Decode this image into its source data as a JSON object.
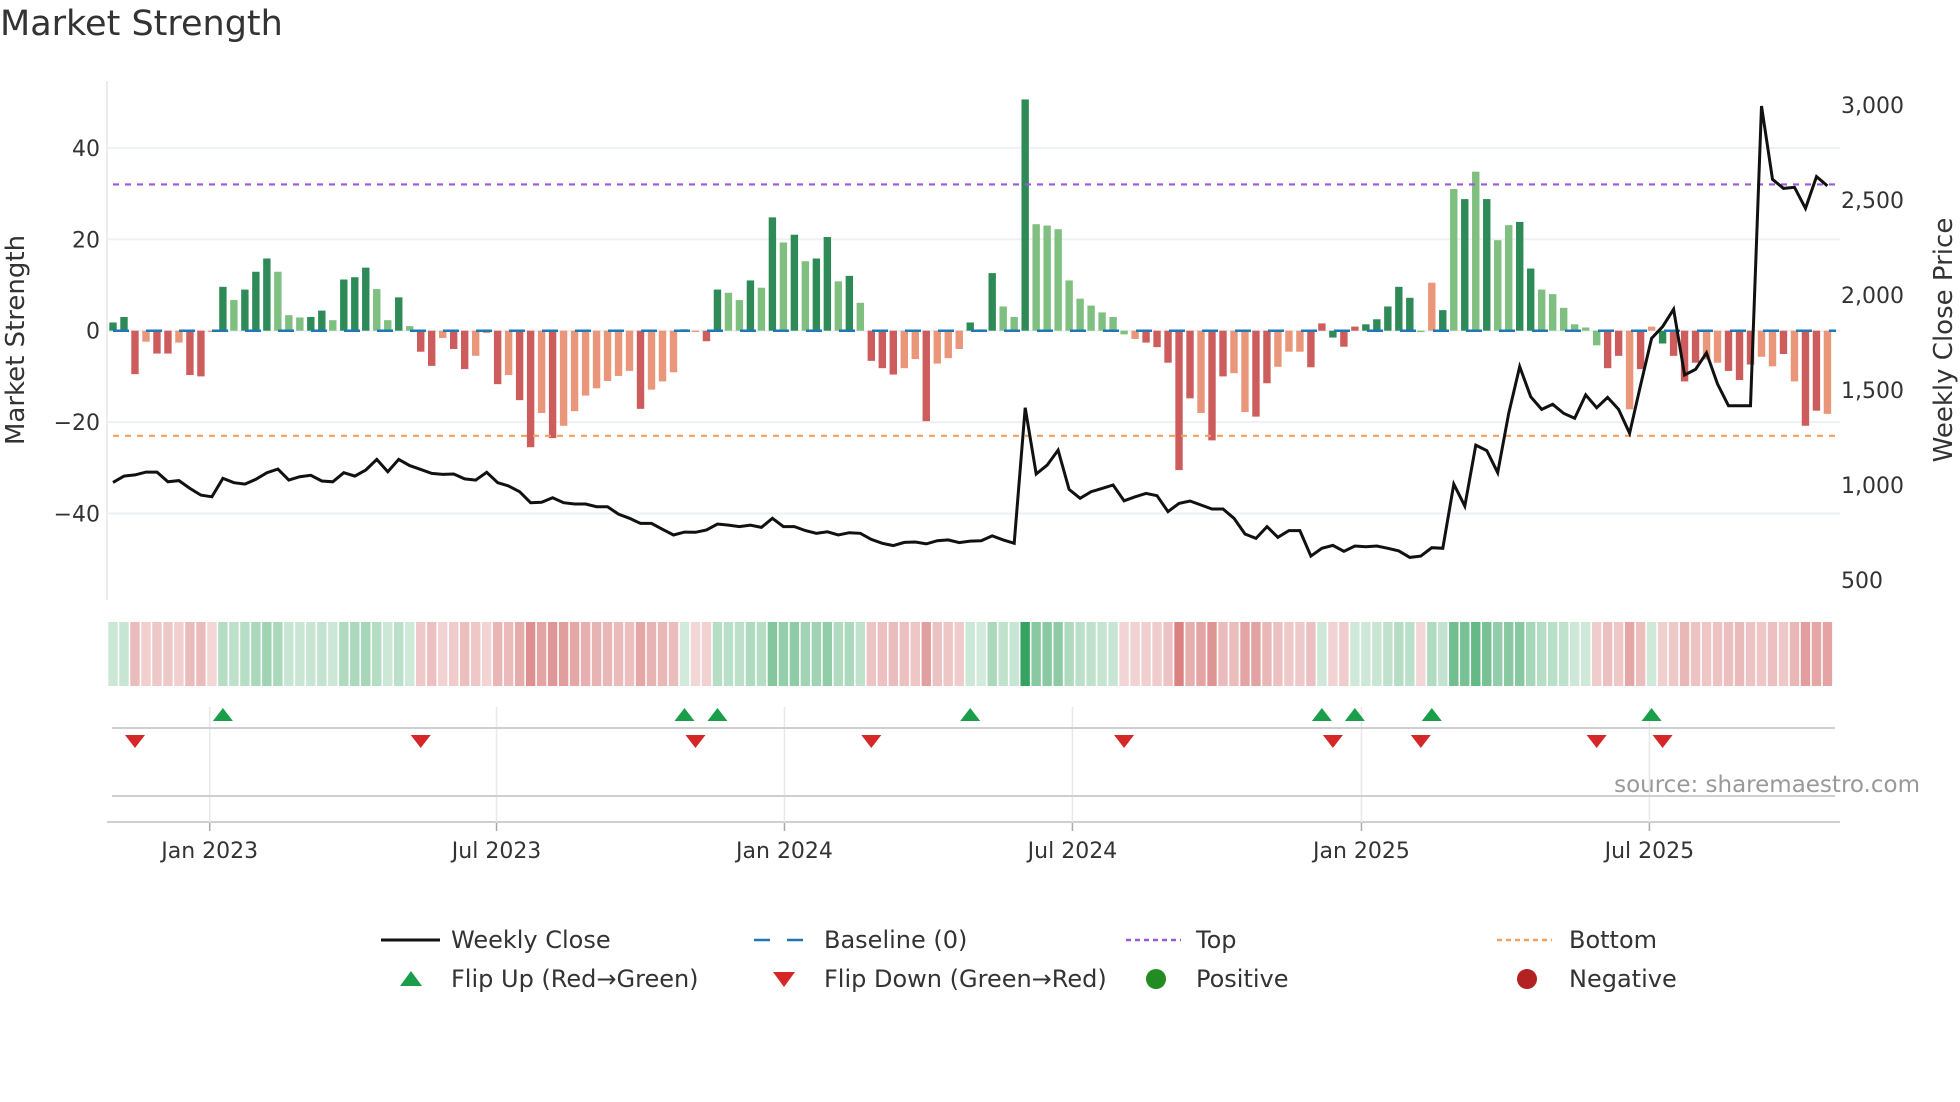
{
  "chart_data": {
    "type": "bar",
    "title": "Market Strength",
    "ylabel": "Market Strength",
    "y2label": "Weekly Close Price",
    "ylim": [
      -59,
      55
    ],
    "y2lim": [
      480,
      3122
    ],
    "yticks": [
      40,
      20,
      0,
      -20,
      -40
    ],
    "ytick_labels": [
      "40",
      "20",
      "0",
      "−20",
      "−40"
    ],
    "y2ticks": [
      3000,
      2500,
      2000,
      1500,
      1000,
      500
    ],
    "y2tick_labels": [
      "3,000",
      "2,500",
      "2,000",
      "1,500",
      "1,000",
      "500"
    ],
    "xticks": [
      {
        "label": "Jan 2023",
        "week_pos": 8.8
      },
      {
        "label": "Jul 2023",
        "week_pos": 34.9
      },
      {
        "label": "Jan 2024",
        "week_pos": 61.1
      },
      {
        "label": "Jul 2024",
        "week_pos": 87.3
      },
      {
        "label": "Jan 2025",
        "week_pos": 113.6
      },
      {
        "label": "Jul 2025",
        "week_pos": 139.8
      }
    ],
    "top_level": 32,
    "bottom_level": -23,
    "baseline": 0,
    "strength": [
      1.8,
      3,
      -9.5,
      -2.4,
      -5,
      -5,
      -2.6,
      -9.7,
      -10,
      -0.3,
      9.6,
      6.7,
      9,
      12.9,
      15.8,
      12.9,
      3.4,
      2.9,
      3,
      4.4,
      2.3,
      11.2,
      11.7,
      13.8,
      9.1,
      2.3,
      7.3,
      1,
      -4.6,
      -7.7,
      -1.6,
      -4,
      -8.4,
      -5.5,
      -0.5,
      -11.7,
      -9.7,
      -15.2,
      -25.5,
      -18,
      -23.5,
      -20.8,
      -17.6,
      -14.2,
      -12.6,
      -11,
      -9.9,
      -8.8,
      -17.1,
      -12.9,
      -11.1,
      -9.1,
      0.3,
      -0.3,
      -2.3,
      9,
      8.3,
      6.7,
      11,
      9.4,
      24.8,
      19.3,
      21,
      15.2,
      15.8,
      20.5,
      10.8,
      12,
      6.1,
      -6.6,
      -8.2,
      -9.6,
      -8.2,
      -6.2,
      -19.8,
      -7.2,
      -6,
      -4,
      1.8,
      0.3,
      12.6,
      5.3,
      3,
      50.6,
      23.3,
      23,
      22.2,
      11,
      7,
      5.5,
      4,
      3,
      -0.8,
      -1.8,
      -2.6,
      -3.6,
      -7,
      -30.5,
      -14.8,
      -18,
      -24,
      -10,
      -9.3,
      -17.8,
      -18.8,
      -11.5,
      -7.9,
      -4.6,
      -4.6,
      -8,
      1.6,
      -1.5,
      -3.5,
      0.9,
      1.4,
      2.5,
      5.3,
      9.6,
      7.2,
      -0.3,
      10.5,
      4.5,
      31,
      28.8,
      34.8,
      28.8,
      19.8,
      23.1,
      23.8,
      13.6,
      9,
      8,
      5,
      1.4,
      0.7,
      -3.2,
      -8.2,
      -5.5,
      -17.2,
      -8.4,
      0.9,
      -2.8,
      -5.5,
      -11.1,
      -7,
      -6.3,
      -7,
      -8.8,
      -10.8,
      -7.4,
      -5.7,
      -7.8,
      -5.1,
      -11.1,
      -20.8,
      -17.5,
      -18.2
    ],
    "bar_state": "DDRrRRrRRrDLDDDLLLDDLDDDLLDLRRrRRrrRrRRrRrrrrrrrRrrrDrRDLLDLDLDLDDLDLRRRrrRrrrDLDLLDLLLLLLLLLrRRRRRrRRrrRRrrrRRDRRDDDDDLrDLDLDLLDDLLLLLLRRrRrDRRRrrRRRrrRrRRrR",
    "weekly_close": [
      1014,
      1047,
      1053,
      1068,
      1068,
      1017,
      1023,
      982,
      947,
      938,
      1035,
      1012,
      1005,
      1030,
      1065,
      1084,
      1026,
      1044,
      1051,
      1021,
      1017,
      1065,
      1047,
      1079,
      1135,
      1070,
      1135,
      1102,
      1082,
      1061,
      1056,
      1058,
      1032,
      1026,
      1067,
      1012,
      995,
      965,
      907,
      909,
      933,
      907,
      900,
      900,
      886,
      886,
      847,
      825,
      798,
      798,
      767,
      737,
      752,
      751,
      763,
      795,
      789,
      781,
      789,
      777,
      825,
      781,
      781,
      760,
      746,
      754,
      737,
      749,
      746,
      714,
      693,
      681,
      698,
      700,
      690,
      707,
      711,
      697,
      705,
      707,
      732,
      711,
      693,
      1407,
      1058,
      1105,
      1184,
      977,
      930,
      965,
      982,
      1000,
      917,
      938,
      956,
      944,
      860,
      903,
      916,
      895,
      874,
      874,
      825,
      742,
      719,
      781,
      725,
      760,
      760,
      626,
      667,
      682,
      651,
      679,
      675,
      679,
      667,
      653,
      619,
      626,
      670,
      667,
      1005,
      889,
      1210,
      1181,
      1065,
      1377,
      1623,
      1465,
      1398,
      1425,
      1377,
      1351,
      1474,
      1407,
      1461,
      1398,
      1272,
      1526,
      1772,
      1833,
      1925,
      1579,
      1609,
      1696,
      1532,
      1417,
      1417,
      1417,
      2995,
      2609,
      2561,
      2567,
      2456,
      2623,
      2574
    ],
    "flip_up_weeks": [
      11,
      53,
      56,
      79,
      111,
      114,
      121,
      141
    ],
    "flip_down_weeks": [
      3,
      29,
      54,
      70,
      93,
      112,
      120,
      136,
      142
    ],
    "legend": [
      {
        "label": "Weekly Close",
        "kind": "line"
      },
      {
        "label": "Baseline (0)",
        "kind": "dash"
      },
      {
        "label": "Top",
        "kind": "dot-top"
      },
      {
        "label": "Bottom",
        "kind": "dot-bottom"
      },
      {
        "label": "Flip Up (Red→Green)",
        "kind": "tri-up"
      },
      {
        "label": "Flip Down (Green→Red)",
        "kind": "tri-down"
      },
      {
        "label": "Positive",
        "kind": "dot-pos"
      },
      {
        "label": "Negative",
        "kind": "dot-neg"
      }
    ],
    "legend_placement": "bottom",
    "grid": true,
    "source": "source: sharemaestro.com"
  },
  "colors": {
    "strong_pos": "#2e8b57",
    "weak_pos": "#7fbf7f",
    "strong_neg": "#cd5c5c",
    "weak_neg": "#e9967a",
    "baseline": "#1f77b4",
    "top": "#9b59d6",
    "bottom": "#f0a060",
    "price": "#111111",
    "flip_up": "#1a9e4a",
    "flip_down": "#d62728",
    "positive": "#228b22",
    "negative": "#b22222"
  }
}
